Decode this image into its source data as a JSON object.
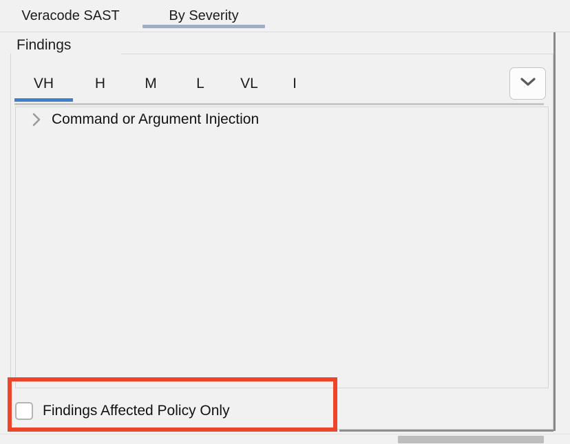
{
  "window": {
    "tool_window_tabs": [
      {
        "label": "Veracode SAST",
        "selected": false
      },
      {
        "label": "By Severity",
        "selected": true
      }
    ],
    "selected_tool_tab_underline_color": "#9fadc2"
  },
  "findings_panel": {
    "title": "Findings",
    "severity_tabs": [
      {
        "label": "VH",
        "selected": true
      },
      {
        "label": "H",
        "selected": false
      },
      {
        "label": "M",
        "selected": false
      },
      {
        "label": "L",
        "selected": false
      },
      {
        "label": "VL",
        "selected": false
      },
      {
        "label": "I",
        "selected": false
      }
    ],
    "selected_severity_underline_color": "#3c80cb",
    "tab_list_button": {
      "icon": "chevron-down-icon"
    },
    "tree": {
      "rows": [
        {
          "toggle_icon": "chevron-right-icon",
          "expanded": false,
          "label": "Command or Argument Injection"
        }
      ]
    },
    "policy_filter": {
      "label": "Findings Affected Policy Only",
      "checked": false
    }
  },
  "annotation": {
    "highlight_color": "#ee4429",
    "target": "policy-filter-row"
  },
  "scrollbar": {
    "orientation": "horizontal",
    "thumb_color": "#bdbdbd"
  }
}
